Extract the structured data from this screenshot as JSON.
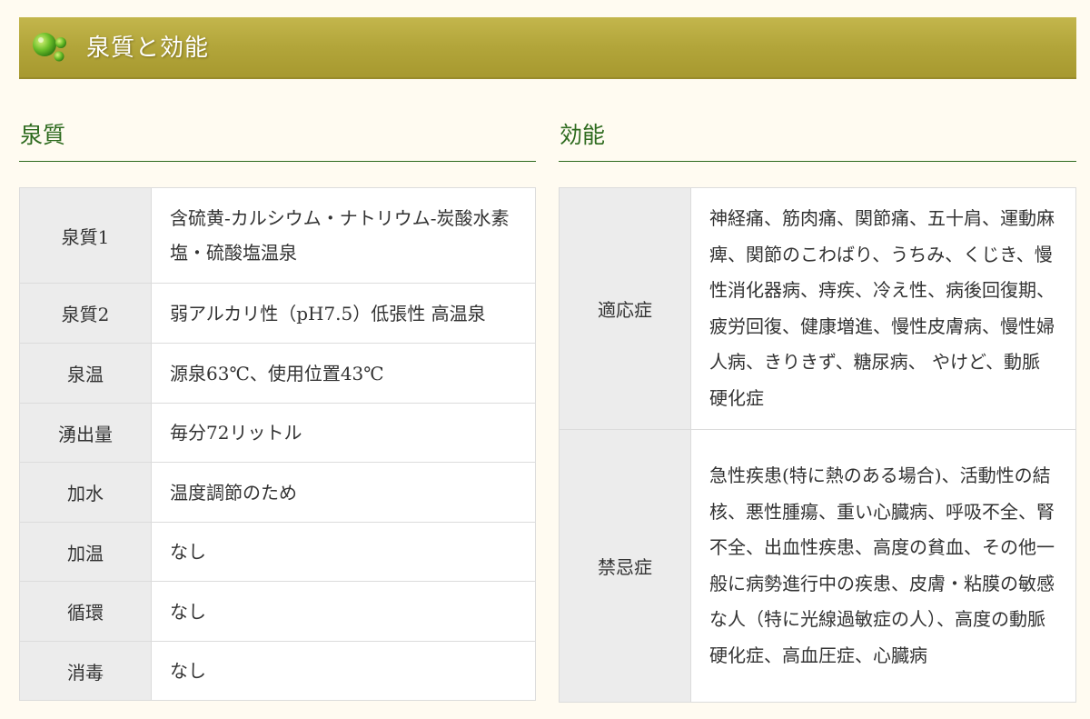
{
  "banner": {
    "title": "泉質と効能"
  },
  "colors": {
    "banner_gold": "#b2a53a",
    "heading_green": "#2d6a1e",
    "header_cell_bg": "#ececec",
    "page_bg": "#fffbf1"
  },
  "icons": {
    "banner_icon": "green-drops-icon"
  },
  "spring": {
    "heading": "泉質",
    "rows": [
      {
        "label": "泉質1",
        "value": "含硫黄-カルシウム・ナトリウム-炭酸水素塩・硫酸塩温泉"
      },
      {
        "label": "泉質2",
        "value": "弱アルカリ性（pH7.5）低張性 高温泉"
      },
      {
        "label": "泉温",
        "value": "源泉63℃、使用位置43℃"
      },
      {
        "label": "湧出量",
        "value": "毎分72リットル"
      },
      {
        "label": "加水",
        "value": "温度調節のため"
      },
      {
        "label": "加温",
        "value": "なし"
      },
      {
        "label": "循環",
        "value": "なし"
      },
      {
        "label": "消毒",
        "value": "なし"
      }
    ]
  },
  "effects": {
    "heading": "効能",
    "rows": [
      {
        "label": "適応症",
        "value": "神経痛、筋肉痛、関節痛、五十肩、運動麻痺、関節のこわばり、うちみ、くじき、慢性消化器病、痔疾、冷え性、病後回復期、疲労回復、健康増進、慢性皮膚病、慢性婦人病、きりきず、糖尿病、 やけど、動脈硬化症"
      },
      {
        "label": "禁忌症",
        "value": "急性疾患(特に熱のある場合)、活動性の結核、悪性腫瘍、重い心臓病、呼吸不全、腎不全、出血性疾患、高度の貧血、その他一般に病勢進行中の疾患、皮膚・粘膜の敏感な人（特に光線過敏症の人）、高度の動脈硬化症、高血圧症、心臓病"
      }
    ]
  }
}
